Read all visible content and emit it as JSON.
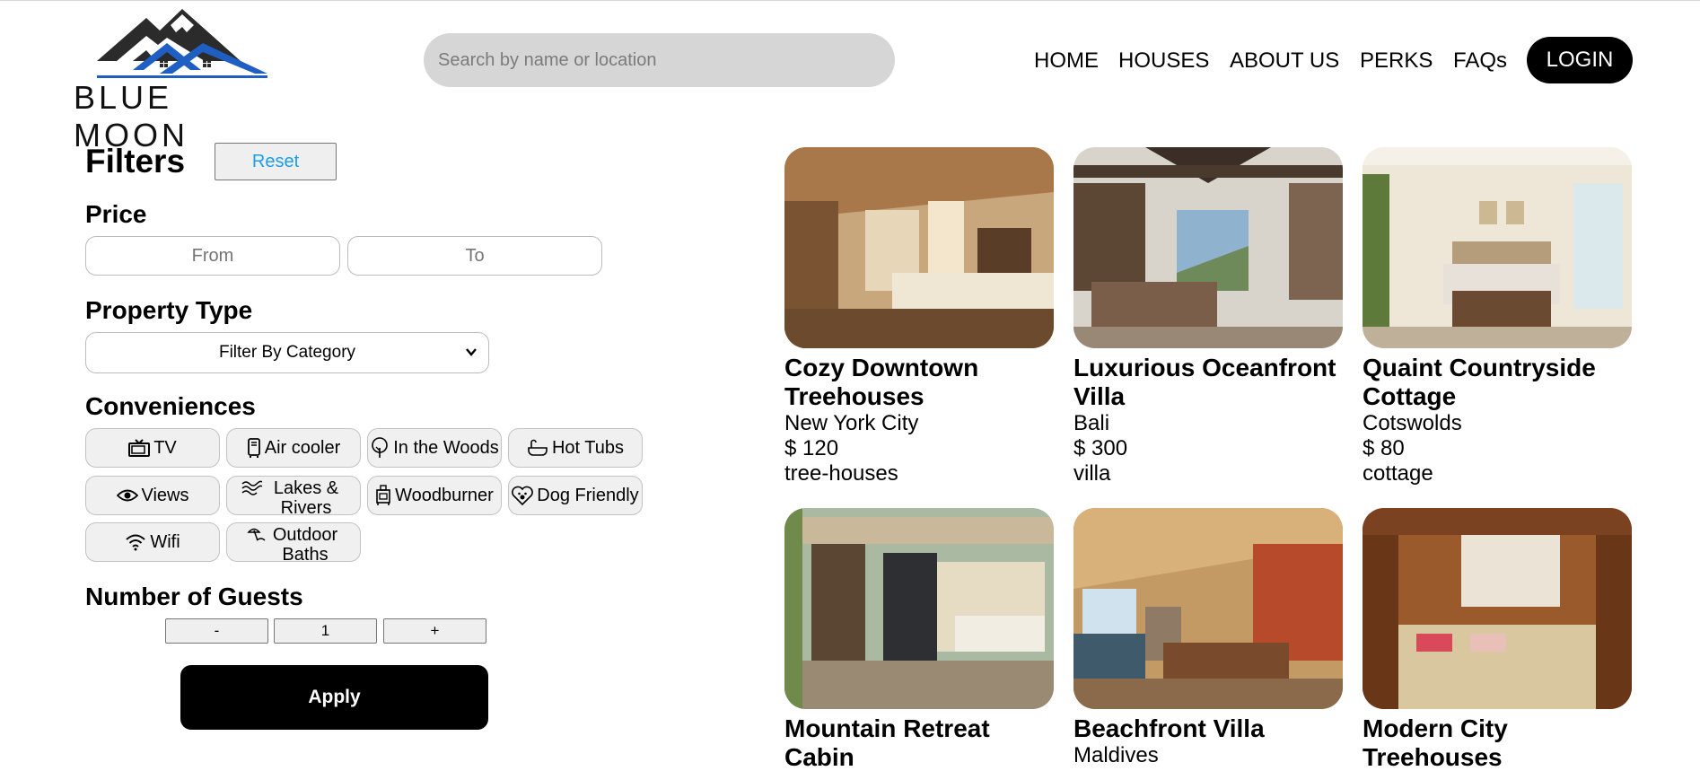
{
  "brand": {
    "name": "BLUE MOON",
    "logo_icon": "mountain-house-logo"
  },
  "search": {
    "placeholder": "Search by name or location"
  },
  "nav": {
    "home": "HOME",
    "houses": "HOUSES",
    "about": "ABOUT US",
    "perks": "PERKS",
    "faqs": "FAQs",
    "login": "LOGIN"
  },
  "filters": {
    "title": "Filters",
    "reset": "Reset",
    "price": {
      "label": "Price",
      "from_placeholder": "From",
      "to_placeholder": "To"
    },
    "property_type": {
      "label": "Property Type",
      "selected": "Filter By Category"
    },
    "conveniences": {
      "label": "Conveniences",
      "items": [
        {
          "label": "TV",
          "icon": "tv-icon"
        },
        {
          "label": "Air cooler",
          "icon": "air-cooler-icon"
        },
        {
          "label": "In the Woods",
          "icon": "tree-icon"
        },
        {
          "label": "Hot Tubs",
          "icon": "bathtub-icon"
        },
        {
          "label": "Views",
          "icon": "eye-icon"
        },
        {
          "label": "Lakes & Rivers",
          "icon": "waves-icon"
        },
        {
          "label": "Woodburner",
          "icon": "stove-icon"
        },
        {
          "label": "Dog Friendly",
          "icon": "paw-heart-icon"
        },
        {
          "label": "Wifi",
          "icon": "wifi-icon"
        },
        {
          "label": "Outdoor Baths",
          "icon": "outdoor-bath-icon"
        }
      ]
    },
    "guests": {
      "label": "Number of Guests",
      "minus": "-",
      "value": "1",
      "plus": "+"
    },
    "apply": "Apply"
  },
  "listings": [
    {
      "title": "Cozy Downtown Treehouses",
      "location": "New York City",
      "price": "$ 120",
      "category": "tree-houses"
    },
    {
      "title": "Luxurious Oceanfront Villa",
      "location": "Bali",
      "price": "$ 300",
      "category": "villa"
    },
    {
      "title": "Quaint Countryside Cottage",
      "location": "Cotswolds",
      "price": "$ 80",
      "category": "cottage"
    },
    {
      "title": "Mountain Retreat Cabin"
    },
    {
      "title": "Beachfront Villa",
      "location": "Maldives"
    },
    {
      "title": "Modern City Treehouses"
    }
  ],
  "colors": {
    "brand_blue": "#1f5fc4",
    "button_black": "#000000",
    "reset_text": "#1a9ee8",
    "search_bg": "#d6d6d6"
  }
}
